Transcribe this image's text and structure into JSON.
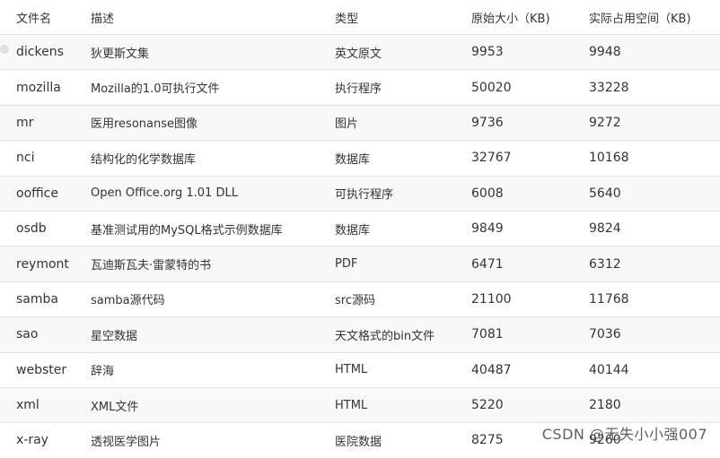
{
  "headers": [
    "文件名",
    "描述",
    "类型",
    "原始大小（KB)",
    "实际占用空间（KB)"
  ],
  "rows": [
    [
      "dickens",
      "狄更斯文集",
      "英文原文",
      "9953",
      "9948"
    ],
    [
      "mozilla",
      "Mozilla的1.0可执行文件",
      "执行程序",
      "50020",
      "33228"
    ],
    [
      "mr",
      "医用resonanse图像",
      "图片",
      "9736",
      "9272"
    ],
    [
      "nci",
      "结构化的化学数据库",
      "数据库",
      "32767",
      "10168"
    ],
    [
      "ooffice",
      "Open Office.org 1.01 DLL",
      "可执行程序",
      "6008",
      "5640"
    ],
    [
      "osdb",
      "基准测试用的MySQL格式示例数据库",
      "数据库",
      "9849",
      "9824"
    ],
    [
      "reymont",
      "瓦迪斯瓦夫·雷蒙特的书",
      "PDF",
      "6471",
      "6312"
    ],
    [
      "samba",
      "samba源代码",
      "src源码",
      "21100",
      "11768"
    ],
    [
      "sao",
      "星空数据",
      "天文格式的bin文件",
      "7081",
      "7036"
    ],
    [
      "webster",
      "辞海",
      "HTML",
      "40487",
      "40144"
    ],
    [
      "xml",
      "XML文件",
      "HTML",
      "5220",
      "2180"
    ],
    [
      "x-ray",
      "透视医学图片",
      "医院数据",
      "8275",
      "9260"
    ]
  ],
  "watermark": "CSDN @无失小小强007"
}
